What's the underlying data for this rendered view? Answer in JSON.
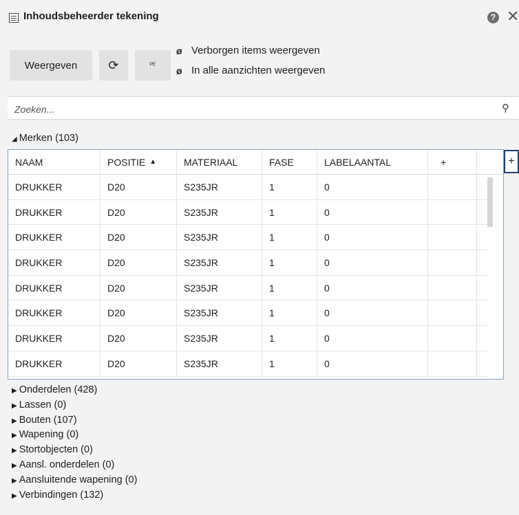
{
  "window": {
    "title": "Inhoudsbeheerder tekening",
    "help_label": "?",
    "close_label": "✕"
  },
  "toolbar": {
    "show_label": "Weergeven",
    "refresh_icon": "⟳",
    "label_icon": "ᴾᴱ",
    "option_hidden": "Verborgen items weergeven",
    "option_all_views": "In alle aanzichten weergeven",
    "eye_icon": "ø"
  },
  "search": {
    "placeholder": "Zoeken...",
    "icon": "⚲"
  },
  "merken": {
    "header": "Merken (103)",
    "columns": [
      "NAAM",
      "POSITIE",
      "MATERIAAL",
      "FASE",
      "LABELAANTAL",
      "+"
    ],
    "sort_indicator": "▲",
    "rows": [
      [
        "DRUKKER",
        "D20",
        "S235JR",
        "1",
        "0",
        ""
      ],
      [
        "DRUKKER",
        "D20",
        "S235JR",
        "1",
        "0",
        ""
      ],
      [
        "DRUKKER",
        "D20",
        "S235JR",
        "1",
        "0",
        ""
      ],
      [
        "DRUKKER",
        "D20",
        "S235JR",
        "1",
        "0",
        ""
      ],
      [
        "DRUKKER",
        "D20",
        "S235JR",
        "1",
        "0",
        ""
      ],
      [
        "DRUKKER",
        "D20",
        "S235JR",
        "1",
        "0",
        ""
      ],
      [
        "DRUKKER",
        "D20",
        "S235JR",
        "1",
        "0",
        ""
      ],
      [
        "DRUKKER",
        "D20",
        "S235JR",
        "1",
        "0",
        ""
      ]
    ],
    "add_column_label": "+"
  },
  "groups": [
    "Onderdelen (428)",
    "Lassen (0)",
    "Bouten (107)",
    "Wapening (0)",
    "Stortobjecten (0)",
    "Aansl. onderdelen (0)",
    "Aansluitende wapening (0)",
    "Verbindingen (132)"
  ],
  "colors": {
    "accent_border": "#1f3f6a",
    "table_border": "#8aa3bf",
    "button_bg": "#e2e2e2"
  }
}
